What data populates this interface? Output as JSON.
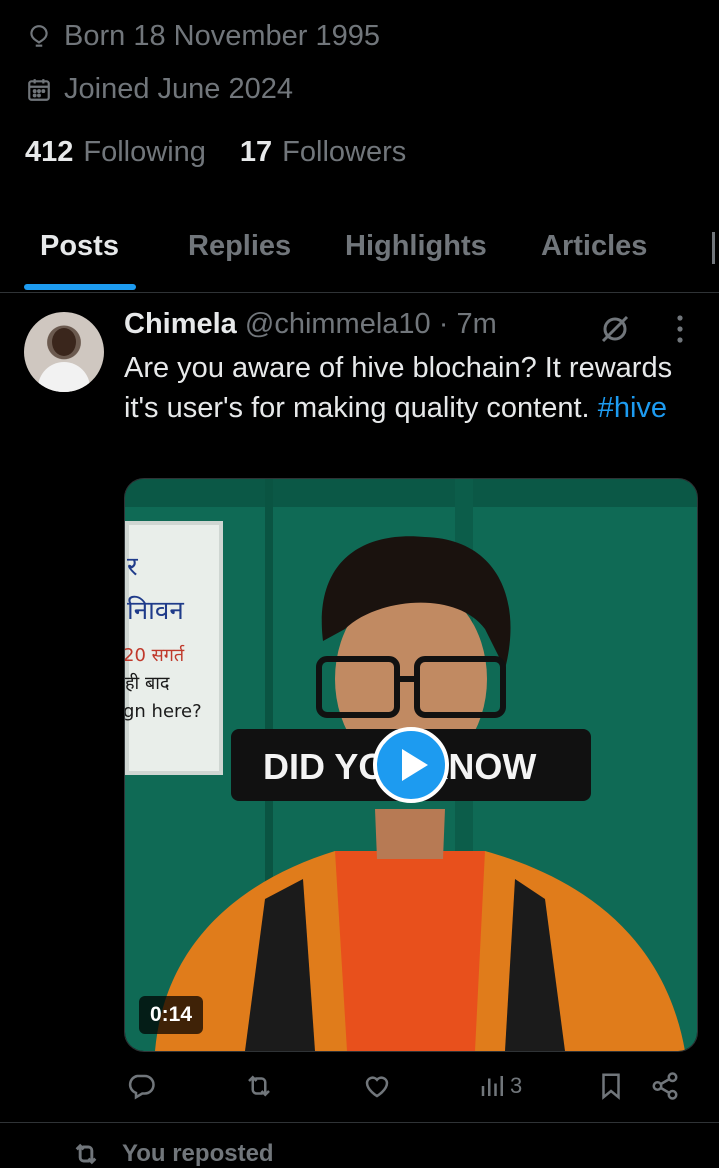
{
  "profile": {
    "born": "Born 18 November 1995",
    "joined": "Joined June 2024",
    "following_count": "412",
    "following_label": "Following",
    "followers_count": "17",
    "followers_label": "Followers"
  },
  "tabs": [
    {
      "label": "Posts",
      "active": true
    },
    {
      "label": "Replies",
      "active": false
    },
    {
      "label": "Highlights",
      "active": false
    },
    {
      "label": "Articles",
      "active": false
    }
  ],
  "post": {
    "author_name": "Chimela",
    "author_handle": "@chimmela10",
    "separator": "·",
    "time": "7m",
    "text": "Are you aware of hive blochain? It rewards it's user's for making quality content.",
    "hashtag": "#hive",
    "media": {
      "caption": "DID YOU KNOW",
      "sign_lines": [
        "र",
        "निावन",
        "20 सगर्त",
        "ही बाद",
        "gn here?"
      ],
      "duration": "0:14"
    },
    "actions": {
      "views": "3"
    }
  },
  "next_item": {
    "reposted_label": "You reposted"
  },
  "colors": {
    "accent": "#1d9bf0",
    "text_primary": "#e7e9ea",
    "text_secondary": "#71767b",
    "background": "#000000"
  },
  "icons": [
    "location-icon",
    "calendar-icon",
    "grok-icon",
    "more-icon",
    "play-icon",
    "reply-icon",
    "repost-icon",
    "like-icon",
    "views-icon",
    "bookmark-icon",
    "share-icon"
  ]
}
